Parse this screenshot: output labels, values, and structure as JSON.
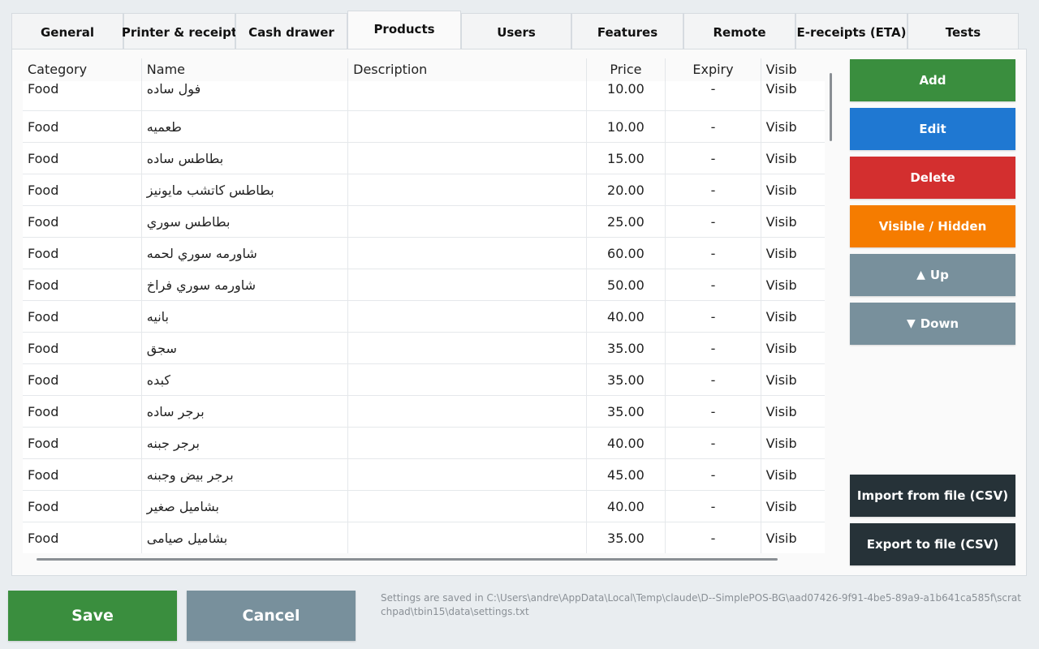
{
  "tabs": [
    {
      "label": "General"
    },
    {
      "label": "Printer & receipt"
    },
    {
      "label": "Cash drawer"
    },
    {
      "label": "Products",
      "active": true
    },
    {
      "label": "Users"
    },
    {
      "label": "Features"
    },
    {
      "label": "Remote"
    },
    {
      "label": "E-receipts (ETA)"
    },
    {
      "label": "Tests"
    }
  ],
  "table": {
    "headers": {
      "category": "Category",
      "name": "Name",
      "description": "Description",
      "price": "Price",
      "expiry": "Expiry",
      "visibility": "Visib"
    },
    "rows": [
      {
        "category": "Food",
        "name": "فول ساده",
        "description": "",
        "price": "10.00",
        "expiry": "-",
        "visibility": "Visib"
      },
      {
        "category": "Food",
        "name": "طعميه",
        "description": "",
        "price": "10.00",
        "expiry": "-",
        "visibility": "Visib"
      },
      {
        "category": "Food",
        "name": "بطاطس ساده",
        "description": "",
        "price": "15.00",
        "expiry": "-",
        "visibility": "Visib"
      },
      {
        "category": "Food",
        "name": "بطاطس كاتشب مايونيز",
        "description": "",
        "price": "20.00",
        "expiry": "-",
        "visibility": "Visib"
      },
      {
        "category": "Food",
        "name": "بطاطس سوري",
        "description": "",
        "price": "25.00",
        "expiry": "-",
        "visibility": "Visib"
      },
      {
        "category": "Food",
        "name": "شاورمه سوري لحمه",
        "description": "",
        "price": "60.00",
        "expiry": "-",
        "visibility": "Visib"
      },
      {
        "category": "Food",
        "name": "شاورمه سوري فراخ",
        "description": "",
        "price": "50.00",
        "expiry": "-",
        "visibility": "Visib"
      },
      {
        "category": "Food",
        "name": "بانيه",
        "description": "",
        "price": "40.00",
        "expiry": "-",
        "visibility": "Visib"
      },
      {
        "category": "Food",
        "name": "سجق",
        "description": "",
        "price": "35.00",
        "expiry": "-",
        "visibility": "Visib"
      },
      {
        "category": "Food",
        "name": "كبده",
        "description": "",
        "price": "35.00",
        "expiry": "-",
        "visibility": "Visib"
      },
      {
        "category": "Food",
        "name": "برجر ساده",
        "description": "",
        "price": "35.00",
        "expiry": "-",
        "visibility": "Visib"
      },
      {
        "category": "Food",
        "name": "برجر جبنه",
        "description": "",
        "price": "40.00",
        "expiry": "-",
        "visibility": "Visib"
      },
      {
        "category": "Food",
        "name": "برجر بيض وجبنه",
        "description": "",
        "price": "45.00",
        "expiry": "-",
        "visibility": "Visib"
      },
      {
        "category": "Food",
        "name": "بشاميل صغير",
        "description": "",
        "price": "40.00",
        "expiry": "-",
        "visibility": "Visib"
      },
      {
        "category": "Food",
        "name": "بشاميل صيامى",
        "description": "",
        "price": "35.00",
        "expiry": "-",
        "visibility": "Visib"
      }
    ]
  },
  "actions": {
    "add": "Add",
    "edit": "Edit",
    "delete": "Delete",
    "toggle_visibility": "Visible / Hidden",
    "up": "Up",
    "down": "Down",
    "import_csv": "Import from file (CSV)",
    "export_csv": "Export to file (CSV)",
    "up_icon": "triangle-up-icon",
    "down_icon": "triangle-down-icon"
  },
  "footer": {
    "save": "Save",
    "cancel": "Cancel",
    "note": "Settings are saved in C:\\Users\\andre\\AppData\\Local\\Temp\\claude\\D--SimplePOS-BG\\aad07426-9f91-4be5-89a9-a1b641ca585f\\scratchpad\\tbin15\\data\\settings.txt"
  },
  "colors": {
    "add": "#3a8e3e",
    "edit": "#1f78d2",
    "delete": "#d32f2f",
    "visibility": "#f57c00",
    "move": "#78909c",
    "file": "#263238",
    "save": "#3a8e3e",
    "cancel": "#78909c"
  }
}
